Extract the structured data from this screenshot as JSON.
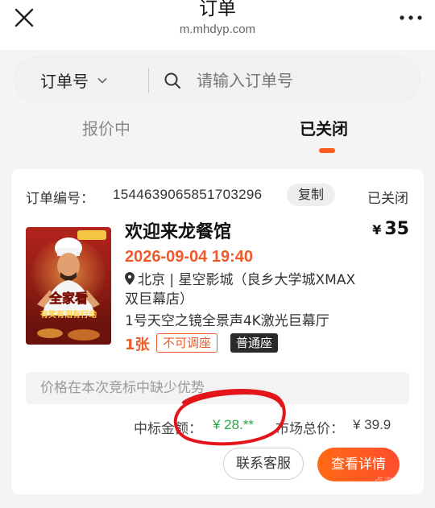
{
  "header": {
    "title": "订单",
    "url": "m.mhdyp.com",
    "close_icon": "close-icon",
    "more_icon": "more-icon"
  },
  "search": {
    "type_label": "订单号",
    "placeholder": "请输入订单号"
  },
  "tabs": [
    {
      "label": "报价中",
      "active": false
    },
    {
      "label": "已关闭",
      "active": true
    }
  ],
  "accent_color": "#ff5a1f",
  "order": {
    "number_label": "订单编号：",
    "number": "1544639065851703296",
    "copy_label": "复制",
    "status": "已关闭",
    "movie_title": "欢迎来龙餐馆",
    "price_currency": "¥",
    "price_value": "35",
    "showtime": "2026-09-04 19:40",
    "venue": "北京 | 星空影城（良乡大学城XMAX双巨幕店）",
    "hall": "1号天空之镜全景声4K激光巨幕厅",
    "tickets": "1张",
    "tag_nochange": "不可调座",
    "tag_seat": "普通座",
    "poster": {
      "headline": "全家看",
      "tagline": "有笑有泪有行动"
    },
    "notice": "价格在本次竞标中缺少优势",
    "win_label": "中标金额：",
    "win_amount": "¥ 28.**",
    "market_label": "市场总价：",
    "market_amount": "¥ 39.9",
    "contact_button": "联系客服",
    "detail_button": "查看详情",
    "detail_ghost": "点击"
  }
}
